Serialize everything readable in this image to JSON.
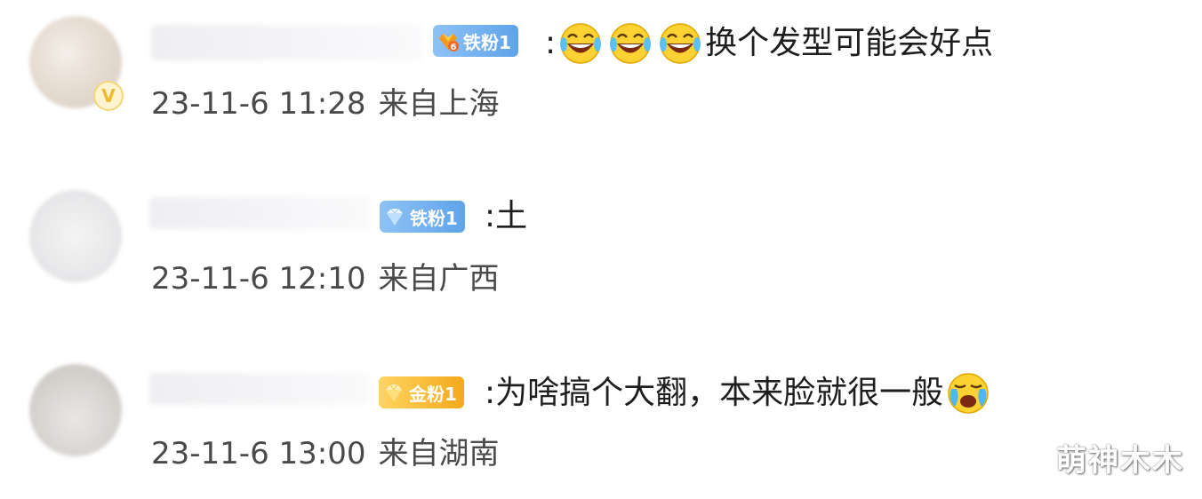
{
  "comments": [
    {
      "badge": {
        "label": "铁粉1",
        "level": "6",
        "tier": "iron-crown"
      },
      "prefix": ":",
      "emojis": [
        "laughing-crying-emoji",
        "laughing-crying-emoji",
        "laughing-crying-emoji"
      ],
      "text": "换个发型可能会好点",
      "time": "23-11-6 11:28",
      "location": "来自上海",
      "verified": true
    },
    {
      "badge": {
        "label": "铁粉1",
        "tier": "iron"
      },
      "prefix": ":",
      "text": "土",
      "time": "23-11-6 12:10",
      "location": "来自广西",
      "verified": false
    },
    {
      "badge": {
        "label": "金粉1",
        "tier": "gold"
      },
      "prefix": ":",
      "text": "为啥搞个大翻，本来脸就很一般",
      "emojis_after": [
        "sobbing-emoji"
      ],
      "time": "23-11-6 13:00",
      "location": "来自湖南",
      "verified": false
    }
  ],
  "verified_badge": {
    "label": "V"
  },
  "watermark": "萌神木木",
  "colors": {
    "iron_badge": "#5fa3ea",
    "gold_badge": "#f4a91c",
    "text": "#1e1e1e",
    "meta_text": "#4a4a4a",
    "verified": "#f0b92d"
  }
}
